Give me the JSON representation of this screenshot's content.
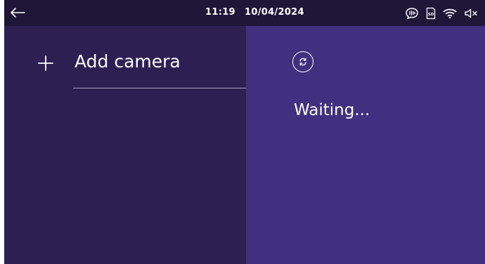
{
  "status_bar": {
    "time": "11:19",
    "date": "10/04/2024",
    "icons": [
      "back-arrow-icon",
      "intercom-speech-icon",
      "sd-card-icon",
      "wifi-icon",
      "speaker-muted-icon"
    ],
    "sd_label": "SD"
  },
  "left_panel": {
    "add_camera_label": "Add camera"
  },
  "right_panel": {
    "status_text": "Waiting..."
  },
  "colors": {
    "status_bar_bg": "#1f1638",
    "left_panel_bg": "#2e1f53",
    "right_panel_bg": "#412f7f",
    "text": "#ffffff"
  }
}
